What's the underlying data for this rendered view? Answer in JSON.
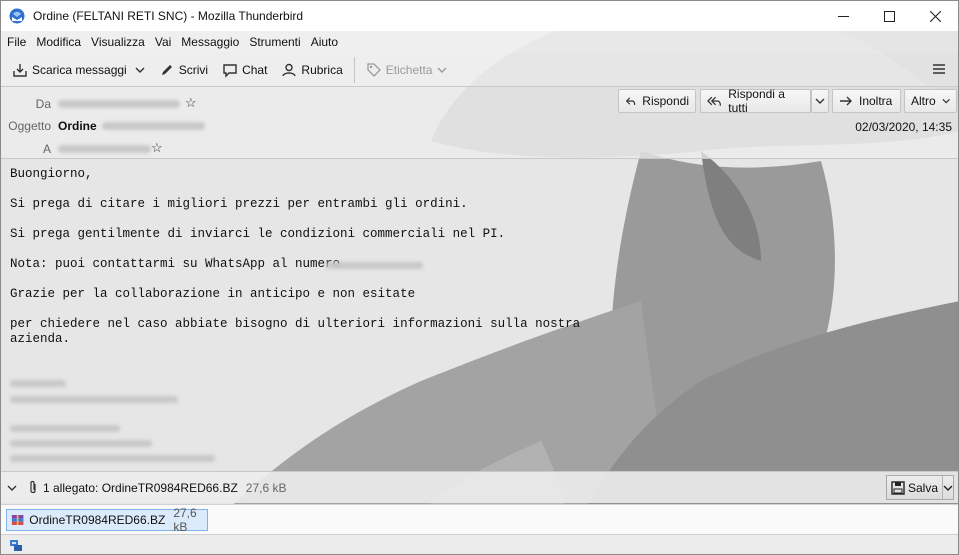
{
  "window": {
    "title": "Ordine (FELTANI RETI SNC) - Mozilla Thunderbird",
    "minimize": "—",
    "maximize": "☐",
    "close": "✕"
  },
  "menu": [
    "File",
    "Modifica",
    "Visualizza",
    "Vai",
    "Messaggio",
    "Strumenti",
    "Aiuto"
  ],
  "toolbar": {
    "get_messages": "Scarica messaggi",
    "write": "Scrivi",
    "chat": "Chat",
    "address_book": "Rubrica",
    "tag": "Etichetta"
  },
  "header": {
    "from_label": "Da",
    "subject_label": "Oggetto",
    "subject": "Ordine",
    "to_label": "A",
    "reply": "Rispondi",
    "reply_all": "Rispondi a tutti",
    "forward": "Inoltra",
    "more": "Altro",
    "date": "02/03/2020, 14:35"
  },
  "body": {
    "p1": "Buongiorno,",
    "p2": "Si prega di citare i migliori prezzi per entrambi gli ordini.",
    "p3": "Si prega gentilmente di inviarci le condizioni commerciali nel PI.",
    "p4": "Nota: puoi contattarmi su WhatsApp al numero",
    "p5": "Grazie per la collaborazione in anticipo e non esitate",
    "p6": "per chiedere nel caso abbiate bisogno di ulteriori informazioni sulla nostra\nazienda."
  },
  "attachments": {
    "summary": "1 allegato: OrdineTR0984RED66.BZ",
    "summary_size": "27,6 kB",
    "save": "Salva",
    "items": [
      {
        "name": "OrdineTR0984RED66.BZ",
        "size": "27,6 kB"
      }
    ]
  },
  "colors": {
    "accent": "#dcebfc",
    "accent_border": "#7eb4ea"
  }
}
